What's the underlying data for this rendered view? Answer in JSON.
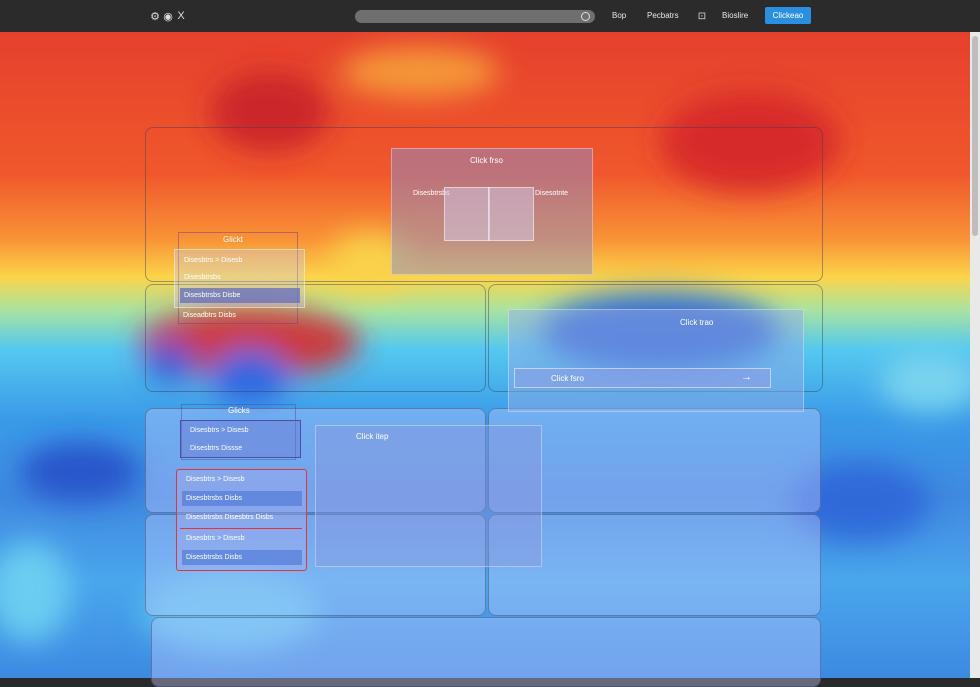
{
  "topbar": {
    "nav_links": [
      "Bop",
      "Pecbatrs",
      "Bioslire"
    ],
    "cta_label": "Clickeao",
    "close_glyph": "X"
  },
  "panels": {
    "top_center_box": {
      "title": "Click frso",
      "left_label": "Disesbtrsbs",
      "right_label": "Disesotnte"
    },
    "dropdown_a": {
      "title": "Glickt",
      "items": [
        "Disesbtrs > Disesb",
        "Disesbtrsbs",
        "Disesbtrsbs Disbe",
        "Diseadbtrs Disbs"
      ]
    },
    "right_box": {
      "title": "Click trao",
      "button_label": "Click fsro"
    },
    "dropdown_b": {
      "title": "Glicks",
      "items": [
        "Disesbtrs > Disesb",
        "Disesbtrs Dissse"
      ]
    },
    "middle_box": {
      "title": "Click itep"
    },
    "dropdown_c": {
      "items": [
        "Disesbtrs > Disesb",
        "Disesbtrsbs Disbs",
        "Disesbtrsbs Disesbtrs Disbs",
        "Disesbtrs > Disesb",
        "Disesbtrsbs Disbs"
      ]
    }
  },
  "colors": {
    "accent": "#2a8fe0",
    "selection_border": "#e0353b"
  }
}
